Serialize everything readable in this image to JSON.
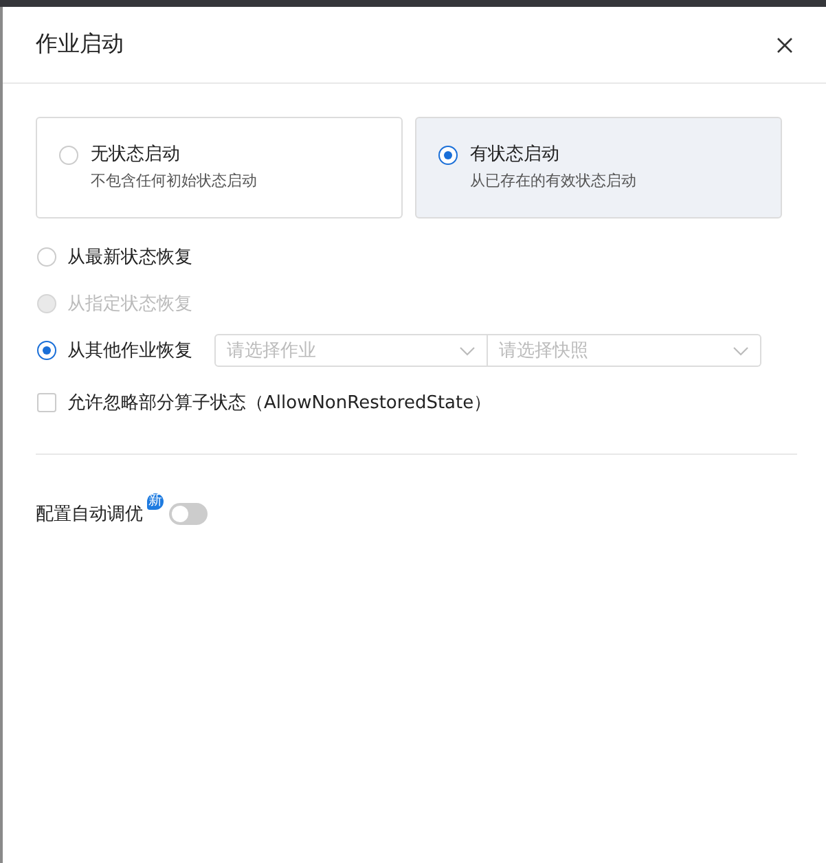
{
  "dialog": {
    "title": "作业启动"
  },
  "mode_cards": [
    {
      "title": "无状态启动",
      "description": "不包含任何初始状态启动",
      "selected": false
    },
    {
      "title": "有状态启动",
      "description": "从已存在的有效状态启动",
      "selected": true
    }
  ],
  "restore_options": [
    {
      "label": "从最新状态恢复",
      "selected": false,
      "disabled": false
    },
    {
      "label": "从指定状态恢复",
      "selected": false,
      "disabled": true
    },
    {
      "label": "从其他作业恢复",
      "selected": true,
      "disabled": false,
      "selects": [
        {
          "placeholder": "请选择作业"
        },
        {
          "placeholder": "请选择快照"
        }
      ]
    }
  ],
  "allow_non_restored": {
    "label": "允许忽略部分算子状态（AllowNonRestoredState）",
    "checked": false
  },
  "auto_tune": {
    "label": "配置自动调优",
    "badge": "新",
    "on": false
  }
}
